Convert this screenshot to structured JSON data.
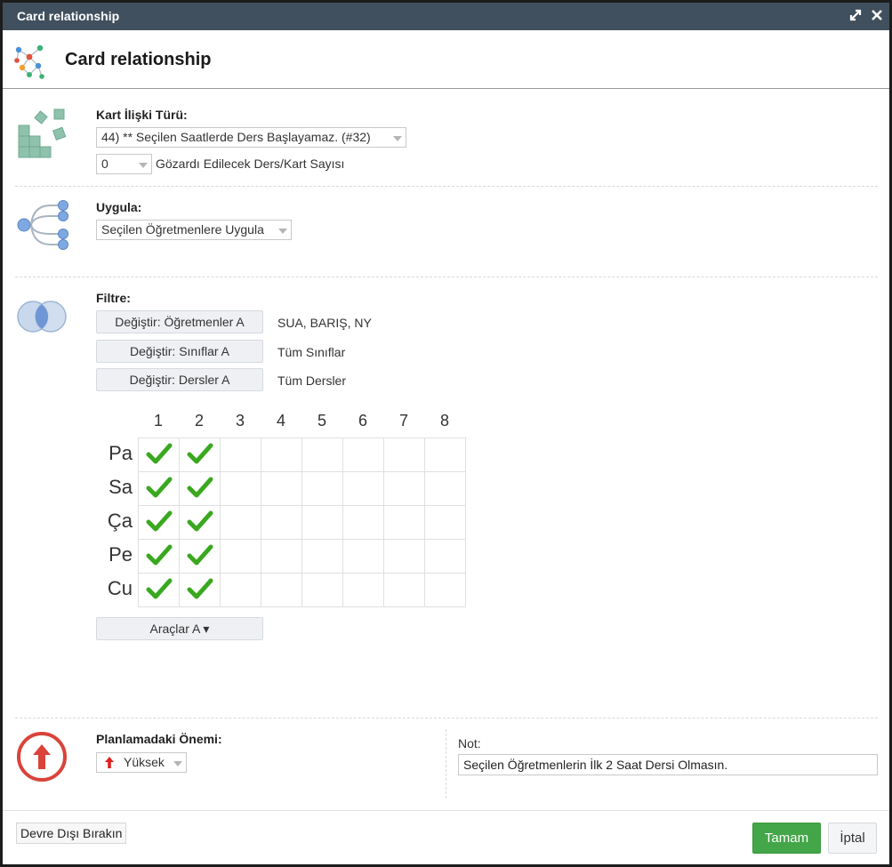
{
  "window": {
    "title": "Card relationship"
  },
  "header": {
    "title": "Card relationship"
  },
  "relation": {
    "label": "Kart İlişki Türü:",
    "type_value": "44) ** Seçilen Saatlerde Ders Başlayamaz. (#32)",
    "ignore_count": "0",
    "ignore_label": "Gözardı Edilecek Ders/Kart Sayısı"
  },
  "apply": {
    "label": "Uygula:",
    "value": "Seçilen Öğretmenlere Uygula"
  },
  "filter": {
    "label": "Filtre:",
    "teachers_button": "Değiştir: Öğretmenler A",
    "teachers_value": "SUA, BARIŞ, NY",
    "classes_button": "Değiştir: Sınıflar A",
    "classes_value": "Tüm Sınıflar",
    "lessons_button": "Değiştir: Dersler A",
    "lessons_value": "Tüm Dersler"
  },
  "grid": {
    "periods": [
      "1",
      "2",
      "3",
      "4",
      "5",
      "6",
      "7",
      "8"
    ],
    "days": [
      "Pa",
      "Sa",
      "Ça",
      "Pe",
      "Cu"
    ],
    "checked": [
      [
        true,
        true,
        false,
        false,
        false,
        false,
        false,
        false
      ],
      [
        true,
        true,
        false,
        false,
        false,
        false,
        false,
        false
      ],
      [
        true,
        true,
        false,
        false,
        false,
        false,
        false,
        false
      ],
      [
        true,
        true,
        false,
        false,
        false,
        false,
        false,
        false
      ],
      [
        true,
        true,
        false,
        false,
        false,
        false,
        false,
        false
      ]
    ],
    "check_color": "#3aa81f"
  },
  "tools": {
    "label": "Araçlar A ▾"
  },
  "priority": {
    "label": "Planlamadaki Önemi:",
    "value": "Yüksek",
    "icon_color": "#e02020"
  },
  "note": {
    "label": "Not:",
    "value": "Seçilen Öğretmenlerin İlk 2 Saat Dersi Olmasın."
  },
  "footer": {
    "disable_label": "Devre Dışı Bırakın",
    "ok_label": "Tamam",
    "cancel_label": "İptal"
  },
  "colors": {
    "titlebar": "#41505e",
    "ok_button": "#43a648",
    "priority_ring": "#d9433a"
  }
}
